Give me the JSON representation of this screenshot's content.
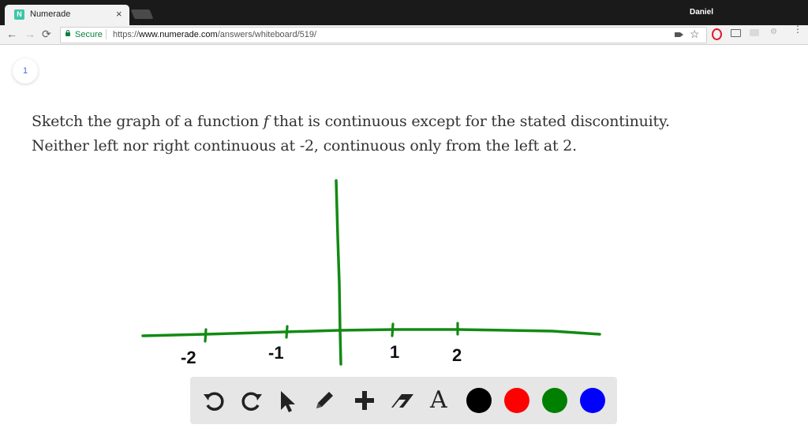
{
  "browser": {
    "tab_title": "Numerade",
    "tab_favicon_letter": "N",
    "tab_close": "×",
    "user_name": "Daniel",
    "nav_back": "←",
    "nav_forward": "→",
    "nav_reload": "⟳",
    "secure_label": "Secure",
    "url_scheme": "https://",
    "url_host": "www.numerade.com",
    "url_path": "/answers/whiteboard/519/",
    "menu": "⋮",
    "star": "☆"
  },
  "page": {
    "step_number": "1",
    "problem_line1_before": "Sketch the graph of a function ",
    "problem_var": "f",
    "problem_line1_after": " that is continuous except for the stated discontinuity.",
    "problem_line2": "Neither left nor right continuous at -2, continuous only from the left at 2."
  },
  "whiteboard": {
    "axis_color": "#138a13",
    "label_color": "#111111",
    "tick_labels": [
      "-2",
      "-1",
      "1",
      "2"
    ]
  },
  "draw_tools": {
    "undo_icon": "undo-icon",
    "redo_icon": "redo-icon",
    "select_icon": "pointer-icon",
    "pen_icon": "pencil-icon",
    "shape_icon": "plus-icon",
    "eraser_icon": "eraser-icon",
    "text_glyph": "A",
    "colors": [
      "#000000",
      "#ff0000",
      "#008000",
      "#0000ff"
    ]
  }
}
